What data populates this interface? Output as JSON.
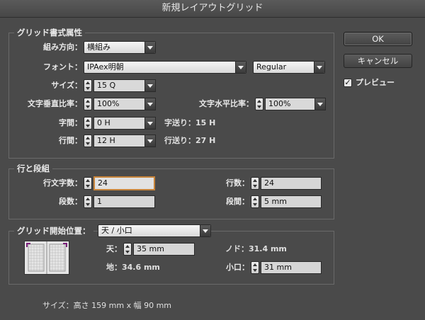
{
  "window": {
    "title": "新規レイアウトグリッド"
  },
  "grid_format": {
    "legend": "グリッド書式属性",
    "direction": {
      "label": "組み方向：",
      "value": "横組み"
    },
    "font": {
      "label": "フォント：",
      "family": "IPAex明朝",
      "style": "Regular"
    },
    "size": {
      "label": "サイズ：",
      "value": "15 Q"
    },
    "vertical_scale": {
      "label": "文字垂直比率：",
      "value": "100%"
    },
    "horizontal_scale": {
      "label": "文字水平比率：",
      "value": "100%"
    },
    "char_spacing": {
      "label": "字間：",
      "value": "0 H"
    },
    "char_pitch": "字送り：15 H",
    "line_spacing": {
      "label": "行間：",
      "value": "12 H"
    },
    "line_pitch": "行送り：27 H"
  },
  "lines_columns": {
    "legend": "行と段組",
    "chars_per_line": {
      "label": "行文字数：",
      "value": "24"
    },
    "lines": {
      "label": "行数：",
      "value": "24"
    },
    "columns": {
      "label": "段数：",
      "value": "1"
    },
    "gutter": {
      "label": "段間：",
      "value": "5 mm"
    }
  },
  "grid_start": {
    "legend": "グリッド開始位置：",
    "value": "天 / 小口",
    "top": {
      "label": "天：",
      "value": "35 mm"
    },
    "nodo": "ノド：31.4 mm",
    "bottom": "地：34.6 mm",
    "fore_edge": {
      "label": "小口：",
      "value": "31 mm"
    }
  },
  "footer": {
    "size_text": "サイズ：高さ 159 mm x 幅 90 mm"
  },
  "buttons": {
    "ok": "OK",
    "cancel": "キャンセル"
  },
  "preview": {
    "label": "プレビュー",
    "checked": true,
    "check_glyph": "✓"
  }
}
